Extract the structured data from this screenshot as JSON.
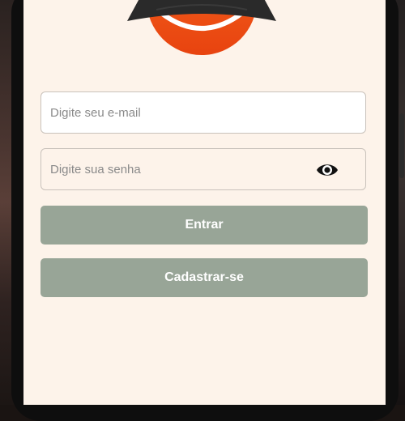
{
  "login": {
    "email_placeholder": "Digite seu e-mail",
    "password_placeholder": "Digite sua senha",
    "submit_label": "Entrar",
    "register_label": "Cadastrar-se"
  },
  "icons": {
    "password_toggle": "eye-icon",
    "logo": "logo-badge"
  },
  "colors": {
    "screen_background": "#fdf3ea",
    "button_background": "#98a597",
    "button_text": "#ffffff",
    "logo_orange": "#f0581c",
    "logo_banner": "#2a2a2a"
  }
}
